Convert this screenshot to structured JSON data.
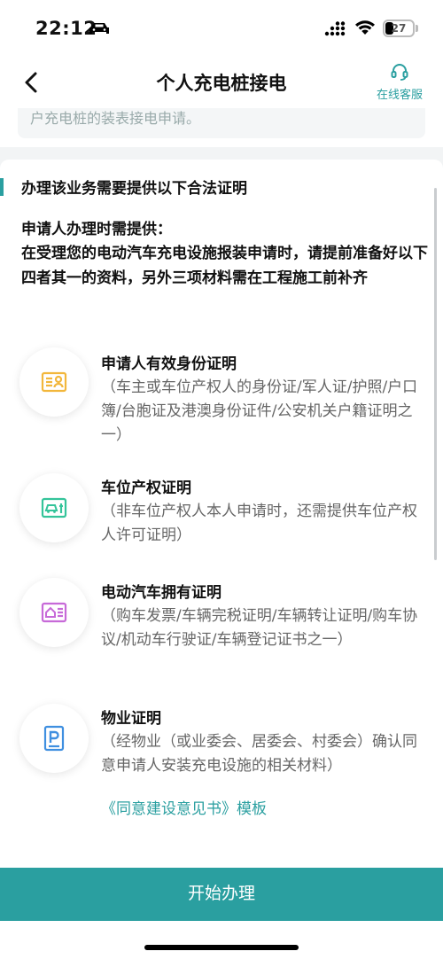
{
  "status_bar": {
    "time": "22:12",
    "battery": "27"
  },
  "nav": {
    "title": "个人充电桩接电",
    "service_label": "在线客服"
  },
  "top_card": {
    "text": "户充电桩的装表接电申请。"
  },
  "section": {
    "title": "办理该业务需要提供以下合法证明",
    "requirement_heading": "申请人办理时需提供：",
    "requirement_desc": "在受理您的电动汽车充电设施报装申请时，请提前准备好以下四者其一的资料，另外三项材料需在工程施工前补齐"
  },
  "items": [
    {
      "title": "申请人有效身份证明",
      "desc": "（车主或车位产权人的身份证/军人证/护照/户口簿/台胞证及港澳身份证件/公安机关户籍证明之一）",
      "icon": "id-card-icon",
      "color": "#f2b73c"
    },
    {
      "title": "车位产权证明",
      "desc": "（非车位产权人本人申请时，还需提供车位产权人许可证明）",
      "icon": "parking-space-icon",
      "color": "#34c49a"
    },
    {
      "title": "电动汽车拥有证明",
      "desc": "（购车发票/车辆完税证明/车辆转让证明/购车协议/机动车行驶证/车辆登记证书之一）",
      "icon": "vehicle-document-icon",
      "color": "#c76ad8"
    },
    {
      "title": "物业证明",
      "desc": "（经物业（或业委会、居委会、村委会）确认同意申请人安装充电设施的相关材料）",
      "icon": "property-certificate-icon",
      "color": "#3f8fe0"
    }
  ],
  "template_link": "《同意建设意见书》模板",
  "start_button": "开始办理",
  "colors": {
    "accent": "#2a9fa0"
  }
}
